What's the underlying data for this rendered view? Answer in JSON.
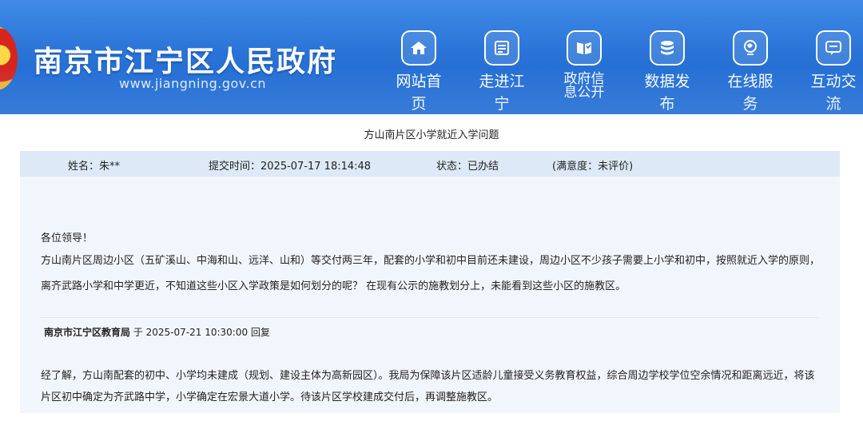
{
  "header": {
    "site_title": "南京市江宁区人民政府",
    "site_url": "www.jiangning.gov.cn",
    "nav": [
      {
        "label": "网站首页",
        "icon": "home-icon"
      },
      {
        "label": "走进江宁",
        "icon": "document-icon"
      },
      {
        "label": "政府信息公开",
        "icon": "book-icon"
      },
      {
        "label": "数据发布",
        "icon": "database-icon"
      },
      {
        "label": "在线服务",
        "icon": "globe-icon"
      },
      {
        "label": "互动交流",
        "icon": "chat-icon"
      }
    ]
  },
  "letter": {
    "title": "方山南片区小学就近入学问题",
    "name": "姓名：朱**",
    "submit_time": "提交时间：2025-07-17 18:14:48",
    "status": "状态：已办结",
    "satisfaction": "(满意度：未评价)",
    "greeting": "各位领导！",
    "body": "方山南片区周边小区（五矿溪山、中海和山、远洋、山和）等交付两三年，配套的小学和初中目前还未建设，周边小区不少孩子需要上小学和初中，按照就近入学的原则，离齐武路小学和中学更近，不知道这些小区入学政策是如何划分的呢？ 在现有公示的施教划分上，未能看到这些小区的施教区。"
  },
  "reply": {
    "department": "南京市江宁区教育局",
    "meta": " 于 2025-07-21 10:30:00 回复",
    "text": "经了解，方山南配套的初中、小学均未建成（规划、建设主体为高新园区）。我局为保障该片区适龄儿童接受义务教育权益，综合周边学校学位空余情况和距离远近，将该片区初中确定为齐武路中学，小学确定在宏景大道小学。待该片区学校建成交付后，再调整施教区。"
  }
}
